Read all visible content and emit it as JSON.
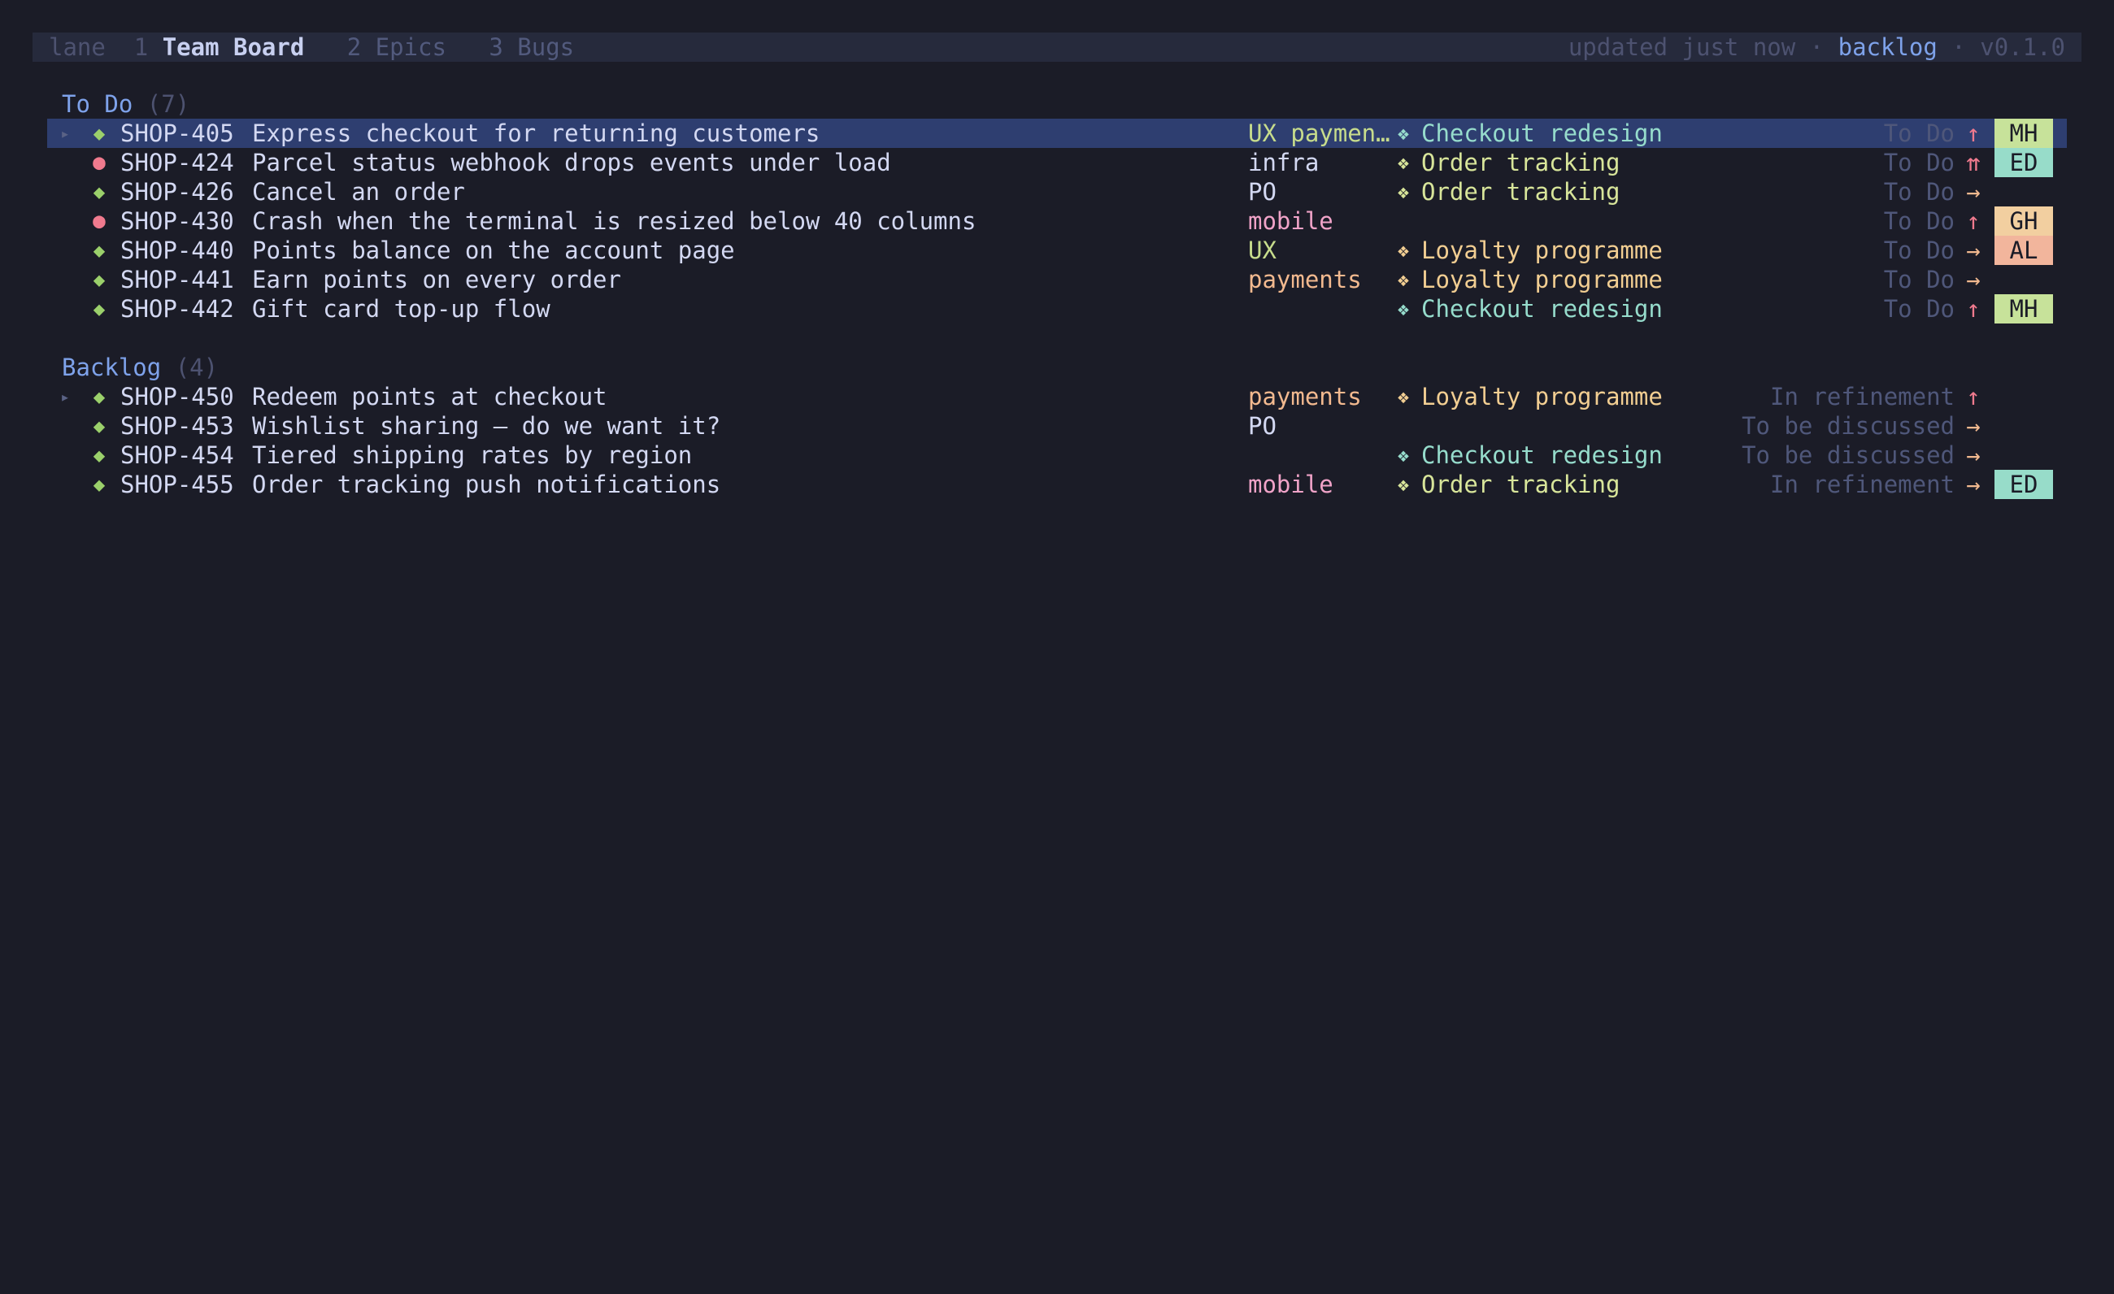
{
  "app": {
    "name": "lane",
    "tabs": [
      {
        "num": "1",
        "label": "Team Board",
        "active": true
      },
      {
        "num": "2",
        "label": "Epics",
        "active": false
      },
      {
        "num": "3",
        "label": "Bugs",
        "active": false
      }
    ],
    "updated": "updated just now",
    "sep": "·",
    "view": "backlog",
    "version": "v0.1.0"
  },
  "sections": [
    {
      "name": "To Do",
      "count": "(7)",
      "rows": [
        {
          "caret": "▸",
          "type": "◆",
          "kind": "story",
          "key": "SHOP-405",
          "title": "Express checkout for returning customers",
          "labels": "UX paymen…",
          "label_class": "lbl-ux",
          "epic_mark": "❖",
          "epic": "Checkout redesign",
          "epic_class": "epic-checkout",
          "status": "To Do",
          "priority": "↑",
          "priority_class": "prio-high",
          "assignee": "MH",
          "assignee_color": "#c7e29a",
          "selected": true
        },
        {
          "caret": "",
          "type": "●",
          "kind": "bug",
          "key": "SHOP-424",
          "title": "Parcel status webhook drops events under load",
          "labels": "infra",
          "label_class": "lbl-infra",
          "epic_mark": "❖",
          "epic": "Order tracking",
          "epic_class": "epic-order",
          "status": "To Do",
          "priority": "⇈",
          "priority_class": "prio-urgent",
          "assignee": "ED",
          "assignee_color": "#97dcc9",
          "selected": false
        },
        {
          "caret": "",
          "type": "◆",
          "kind": "story",
          "key": "SHOP-426",
          "title": "Cancel an order",
          "labels": "PO",
          "label_class": "lbl-po",
          "epic_mark": "❖",
          "epic": "Order tracking",
          "epic_class": "epic-order",
          "status": "To Do",
          "priority": "→",
          "priority_class": "prio-med",
          "assignee": "",
          "assignee_color": "",
          "selected": false
        },
        {
          "caret": "",
          "type": "●",
          "kind": "bug",
          "key": "SHOP-430",
          "title": "Crash when the terminal is resized below 40 columns",
          "labels": "mobile",
          "label_class": "lbl-mobile",
          "epic_mark": "",
          "epic": "",
          "epic_class": "",
          "status": "To Do",
          "priority": "↑",
          "priority_class": "prio-high",
          "assignee": "GH",
          "assignee_color": "#f2cfa0",
          "selected": false
        },
        {
          "caret": "",
          "type": "◆",
          "kind": "story",
          "key": "SHOP-440",
          "title": "Points balance on the account page",
          "labels": "UX",
          "label_class": "lbl-ux",
          "epic_mark": "❖",
          "epic": "Loyalty programme",
          "epic_class": "epic-loyalty",
          "status": "To Do",
          "priority": "→",
          "priority_class": "prio-med",
          "assignee": "AL",
          "assignee_color": "#f2b59c",
          "selected": false
        },
        {
          "caret": "",
          "type": "◆",
          "kind": "story",
          "key": "SHOP-441",
          "title": "Earn points on every order",
          "labels": "payments",
          "label_class": "lbl-payments",
          "epic_mark": "❖",
          "epic": "Loyalty programme",
          "epic_class": "epic-loyalty",
          "status": "To Do",
          "priority": "→",
          "priority_class": "prio-med",
          "assignee": "",
          "assignee_color": "",
          "selected": false
        },
        {
          "caret": "",
          "type": "◆",
          "kind": "story",
          "key": "SHOP-442",
          "title": "Gift card top-up flow",
          "labels": "",
          "label_class": "",
          "epic_mark": "❖",
          "epic": "Checkout redesign",
          "epic_class": "epic-checkout",
          "status": "To Do",
          "priority": "↑",
          "priority_class": "prio-high",
          "assignee": "MH",
          "assignee_color": "#c7e29a",
          "selected": false
        }
      ]
    },
    {
      "name": "Backlog",
      "count": "(4)",
      "rows": [
        {
          "caret": "▸",
          "type": "◆",
          "kind": "story",
          "key": "SHOP-450",
          "title": "Redeem points at checkout",
          "labels": "payments",
          "label_class": "lbl-payments",
          "epic_mark": "❖",
          "epic": "Loyalty programme",
          "epic_class": "epic-loyalty",
          "status": "In refinement",
          "priority": "↑",
          "priority_class": "prio-high",
          "assignee": "",
          "assignee_color": "",
          "selected": false
        },
        {
          "caret": "",
          "type": "◆",
          "kind": "story",
          "key": "SHOP-453",
          "title": "Wishlist sharing — do we want it?",
          "labels": "PO",
          "label_class": "lbl-po",
          "epic_mark": "",
          "epic": "",
          "epic_class": "",
          "status": "To be discussed",
          "priority": "→",
          "priority_class": "prio-med",
          "assignee": "",
          "assignee_color": "",
          "selected": false
        },
        {
          "caret": "",
          "type": "◆",
          "kind": "story",
          "key": "SHOP-454",
          "title": "Tiered shipping rates by region",
          "labels": "",
          "label_class": "",
          "epic_mark": "❖",
          "epic": "Checkout redesign",
          "epic_class": "epic-checkout",
          "status": "To be discussed",
          "priority": "→",
          "priority_class": "prio-med",
          "assignee": "",
          "assignee_color": "",
          "selected": false
        },
        {
          "caret": "",
          "type": "◆",
          "kind": "story",
          "key": "SHOP-455",
          "title": "Order tracking push notifications",
          "labels": "mobile",
          "label_class": "lbl-mobile",
          "epic_mark": "❖",
          "epic": "Order tracking",
          "epic_class": "epic-order",
          "status": "In refinement",
          "priority": "→",
          "priority_class": "prio-med",
          "assignee": "ED",
          "assignee_color": "#97dcc9",
          "selected": false
        }
      ]
    }
  ]
}
